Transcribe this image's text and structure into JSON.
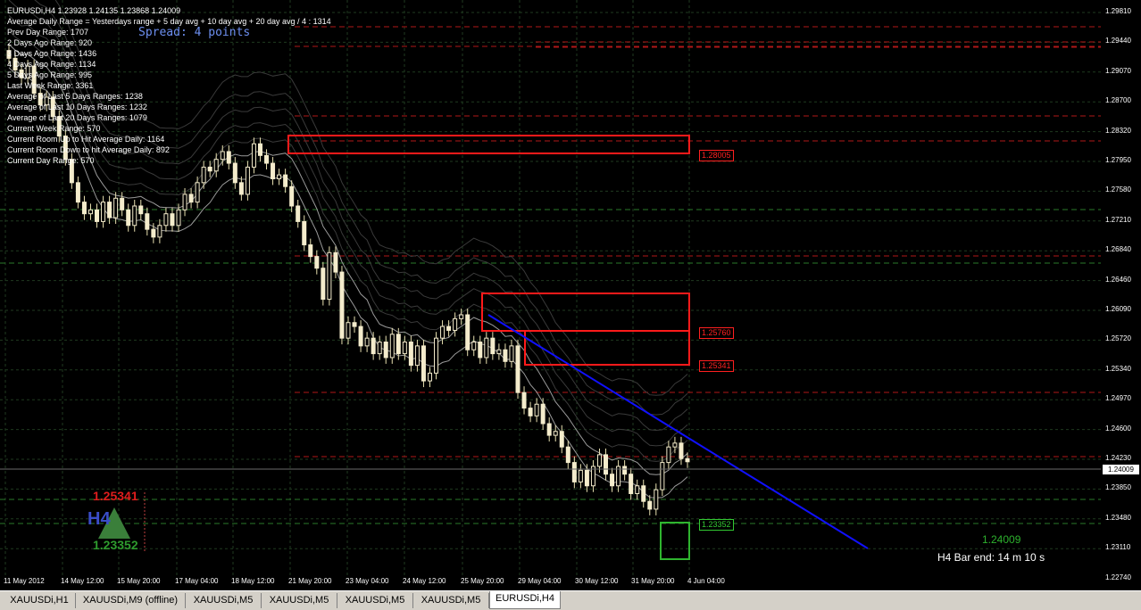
{
  "window": {
    "symbol_header": "EURUSDi,H4  1.23928 1.24135 1.23868 1.24009",
    "spread": "Spread: 4 points"
  },
  "info_lines": [
    "Average Daily Range = Yesterdays range + 5 day avg + 10 day avg + 20 day avg / 4 : 1314",
    "Prev Day Range: 1707",
    "2 Days Ago Range: 920",
    "3 Days Ago Range: 1436",
    "4 Days Ago Range: 1134",
    "5 Days Ago Range: 995",
    "Last Week Range: 3361",
    "Average of Last 5 Days Ranges: 1238",
    "Average of Last 10 Days Ranges: 1232",
    "Average of Last 20 Days Ranges: 1079",
    "Current Week Range: 570",
    "Current Room Up to Hit Average Daily:      1164",
    "Current Room Down to hit Average Daily: 892",
    "Current Day Range: 570"
  ],
  "price_axis": [
    "1.29810",
    "1.29440",
    "1.29070",
    "1.28700",
    "1.28320",
    "1.27950",
    "1.27580",
    "1.27210",
    "1.26840",
    "1.26460",
    "1.26090",
    "1.25720",
    "1.25340",
    "1.24970",
    "1.24600",
    "1.24230",
    "1.23850",
    "1.23480",
    "1.23110",
    "1.22740"
  ],
  "current_price": "1.24009",
  "time_axis": [
    "11 May 2012",
    "14 May 12:00",
    "15 May 20:00",
    "17 May 04:00",
    "18 May 12:00",
    "21 May 20:00",
    "23 May 04:00",
    "24 May 12:00",
    "25 May 20:00",
    "29 May 04:00",
    "30 May 12:00",
    "31 May 20:00",
    "4 Jun 04:00"
  ],
  "levels": [
    {
      "label": "1.28005",
      "color": "#ff2020"
    },
    {
      "label": "1.25760",
      "color": "#ff2020"
    },
    {
      "label": "1.25341",
      "color": "#ff2020"
    },
    {
      "label": "1.23352",
      "color": "#32c832"
    }
  ],
  "h4_widget": {
    "tag": "H4",
    "high": "1.25341",
    "low": "1.23352"
  },
  "bid_text": "1.24009",
  "bar_end": "H4 Bar end:  14 m 10 s",
  "tabs": [
    {
      "label": "XAUUSDi,H1",
      "active": false
    },
    {
      "label": "XAUUSDi,M9 (offline)",
      "active": false
    },
    {
      "label": "XAUUSDi,M5",
      "active": false
    },
    {
      "label": "XAUUSDi,M5",
      "active": false
    },
    {
      "label": "XAUUSDi,M5",
      "active": false
    },
    {
      "label": "XAUUSDi,M5",
      "active": false
    },
    {
      "label": "EURUSDi,H4",
      "active": true
    }
  ],
  "chart_data": {
    "type": "candlestick",
    "symbol": "EURUSDi",
    "timeframe": "H4",
    "ylim": [
      1.2255,
      1.2995
    ],
    "closes": [
      1.292,
      1.2905,
      1.2895,
      1.291,
      1.2875,
      1.286,
      1.287,
      1.2845,
      1.282,
      1.279,
      1.276,
      1.2735,
      1.272,
      1.2725,
      1.271,
      1.2735,
      1.2715,
      1.274,
      1.2725,
      1.2705,
      1.273,
      1.272,
      1.27,
      1.269,
      1.2705,
      1.272,
      1.2705,
      1.2725,
      1.2745,
      1.2735,
      1.276,
      1.278,
      1.2775,
      1.279,
      1.28,
      1.2785,
      1.276,
      1.2745,
      1.278,
      1.281,
      1.2795,
      1.2785,
      1.2765,
      1.277,
      1.2755,
      1.273,
      1.271,
      1.268,
      1.2665,
      1.265,
      1.261,
      1.267,
      1.2645,
      1.256,
      1.258,
      1.2575,
      1.255,
      1.256,
      1.254,
      1.2555,
      1.2535,
      1.2565,
      1.254,
      1.2555,
      1.2525,
      1.255,
      1.2505,
      1.2515,
      1.256,
      1.2575,
      1.257,
      1.2585,
      1.259,
      1.2545,
      1.2555,
      1.2535,
      1.256,
      1.254,
      1.2545,
      1.253,
      1.255,
      1.249,
      1.247,
      1.246,
      1.2475,
      1.245,
      1.2435,
      1.244,
      1.242,
      1.24,
      1.2375,
      1.239,
      1.237,
      1.2395,
      1.241,
      1.2385,
      1.237,
      1.2395,
      1.2385,
      1.236,
      1.237,
      1.235,
      1.234,
      1.2365,
      1.24,
      1.242,
      1.2425,
      1.2405,
      1.2401
    ],
    "ma_fast_hint": "white moving average bands",
    "trendline": "descending blue",
    "boxes": [
      "1.2800-1.2825",
      "1.2534-1.2625",
      "1.2298-1.2335"
    ]
  }
}
